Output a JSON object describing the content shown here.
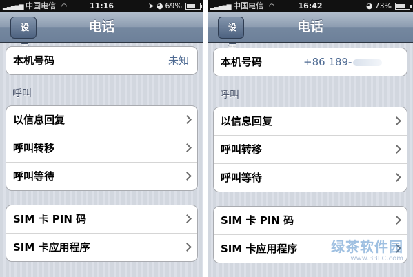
{
  "left": {
    "status": {
      "carrier": "中国电信",
      "time": "11:16",
      "battery": "69%",
      "battery_level": 0.69
    },
    "nav": {
      "back_label": "设置",
      "title": "电话"
    },
    "my_number": {
      "label": "本机号码",
      "value": "未知"
    },
    "call_section": {
      "header": "呼叫",
      "items": [
        {
          "label": "以信息回复"
        },
        {
          "label": "呼叫转移"
        },
        {
          "label": "呼叫等待"
        }
      ]
    },
    "sim_section": {
      "items": [
        {
          "label": "SIM 卡 PIN 码"
        },
        {
          "label": "SIM 卡应用程序"
        }
      ]
    }
  },
  "right": {
    "status": {
      "carrier": "中国电信",
      "time": "16:42",
      "battery": "73%",
      "battery_level": 0.73
    },
    "nav": {
      "back_label": "设置",
      "title": "电话"
    },
    "my_number": {
      "label": "本机号码",
      "value": "+86 189-"
    },
    "call_section": {
      "header": "呼叫",
      "items": [
        {
          "label": "以信息回复"
        },
        {
          "label": "呼叫转移"
        },
        {
          "label": "呼叫等待"
        }
      ]
    },
    "sim_section": {
      "items": [
        {
          "label": "SIM 卡 PIN 码"
        },
        {
          "label": "SIM 卡应用程序"
        }
      ]
    }
  },
  "watermark": {
    "text": "绿茶软件园",
    "url": "www.33LC.com"
  }
}
